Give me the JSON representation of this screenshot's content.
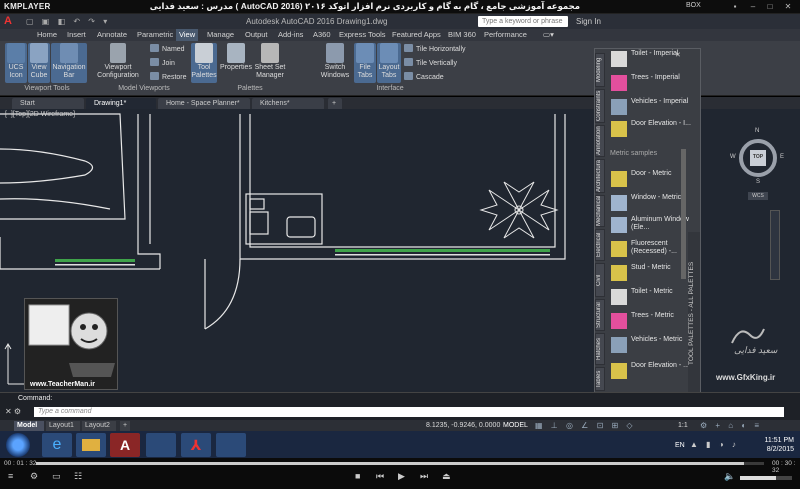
{
  "player": {
    "logo": "KMPLAYER",
    "title": "مجموعه آموزشی جامع ، گام به گام و کاربردی نرم افزار اتوکد ۲۰۱۶ (AutoCAD 2016 ) مدرس : سعید فدایی ( تیچرمن ) گروه آموزشی پادشاه گرافیست ها",
    "box_label": "BOX",
    "time_current": "00 : 01 : 32",
    "time_total": "00 : 30 : 32",
    "progress_fraction": 0.973,
    "volume_fraction": 0.7
  },
  "app": {
    "window_title": "Autodesk AutoCAD 2016   Drawing1.dwg",
    "search_placeholder": "Type a keyword or phrase",
    "sign_in": "Sign In"
  },
  "ribbon_tabs": [
    "Home",
    "Insert",
    "Annotate",
    "Parametric",
    "View",
    "Manage",
    "Output",
    "Add-ins",
    "A360",
    "Express Tools",
    "Featured Apps",
    "BIM 360",
    "Performance"
  ],
  "active_tab": "View",
  "ribbon": {
    "ucs_icon": "UCS Icon",
    "view_cube": "View Cube",
    "navigation_bar": "Navigation Bar",
    "viewport_configuration": "Viewport Configuration",
    "named": "Named",
    "join": "Join",
    "restore": "Restore",
    "tool_palettes": "Tool Palettes",
    "properties": "Properties",
    "sheet_set_manager": "Sheet Set Manager",
    "switch_windows": "Switch Windows",
    "file_tabs": "File Tabs",
    "layout_tabs": "Layout Tabs",
    "tile_horizontally": "Tile Horizontally",
    "tile_vertically": "Tile Vertically",
    "cascade": "Cascade",
    "groups": [
      "Viewport Tools",
      "Model Viewports",
      "Palettes",
      "Interface"
    ]
  },
  "doc_tabs": [
    "Start",
    "Drawing1*",
    "Home - Space Planner*",
    "Kitchens*"
  ],
  "active_doc_tab": "Drawing1*",
  "viewport_label": "[–][Top][2D Wireframe]",
  "viewcube": {
    "face": "TOP",
    "north": "N",
    "south": "S",
    "east": "E",
    "west": "W",
    "wcs": "WCS"
  },
  "palette": {
    "vertical_tabs": [
      "Modeling",
      "Constraints",
      "Annotation",
      "Architectural",
      "Mechanical",
      "Electrical",
      "Civil",
      "Structural",
      "Hatches",
      "Tables"
    ],
    "title": "TOOL PALETTES - ALL PALETTES",
    "items_top": [
      "Toilet - Imperial",
      "Trees - Imperial",
      "Vehicles - Imperial",
      "Door Elevation - I..."
    ],
    "section": "Metric samples",
    "items_metric": [
      "Door - Metric",
      "Window - Metric",
      "Aluminum Window (Ele...",
      "Fluorescent (Recessed) -...",
      "Stud - Metric",
      "Toilet - Metric",
      "Trees - Metric",
      "Vehicles - Metric",
      "Door Elevation - ..."
    ]
  },
  "command": {
    "label": "Command:",
    "placeholder": "Type a command"
  },
  "layout_tabs": [
    "Model",
    "Layout1",
    "Layout2"
  ],
  "status": {
    "coords": "8.1235, -0.9246, 0.0000",
    "model": "MODEL",
    "scale": "1:1"
  },
  "taskbar": {
    "lang": "EN",
    "time": "11:51 PM",
    "date": "8/2/2015"
  },
  "watermarks": {
    "teacher_url": "www.TeacherMan.ir",
    "gfx_url": "www.GfxKing.ir",
    "gfx_sig": "سعید فدایی"
  }
}
